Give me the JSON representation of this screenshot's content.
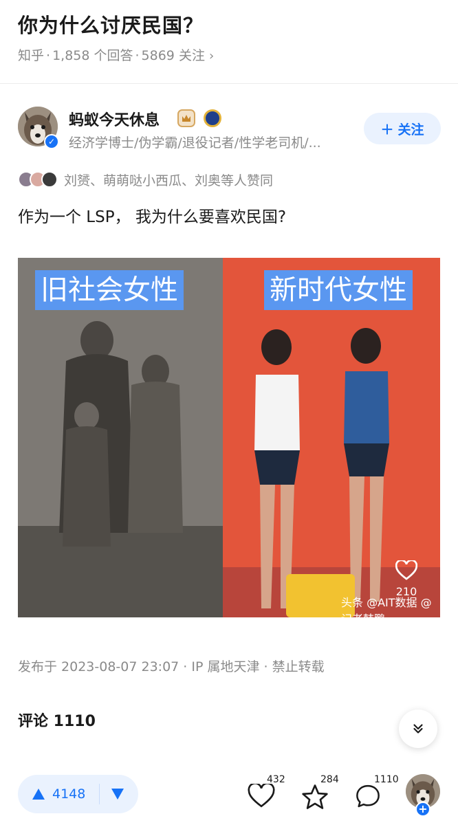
{
  "question": {
    "title": "你为什么讨厌民国？",
    "source": "知乎",
    "answers_count": "1,858 个回答",
    "followers": "5869 关注",
    "meta_chevron": "›"
  },
  "author": {
    "name": "蚂蚁今天休息",
    "bio": "经济学博士/伪学霸/退役记者/性学老司机/...",
    "follow_label": "关注",
    "follow_plus": "＋",
    "verify_mark": "✓"
  },
  "voters": {
    "text": "刘赟、萌萌哒小西瓜、刘奥等人赞同"
  },
  "answer": {
    "text": "作为一个 LSP， 我为什么要喜欢民国?"
  },
  "image": {
    "left_caption": "旧社会女性",
    "right_caption": "新时代女性",
    "like_count": "210",
    "watermark": "头条 @AIT数据 @记者韩鹏"
  },
  "meta": {
    "published": "发布于 2023-08-07 23:07 · IP 属地天津 · 禁止转载"
  },
  "comments": {
    "title": "评论 1110"
  },
  "bottom_bar": {
    "upvotes": "4148",
    "likes": "432",
    "favorites": "284",
    "comments": "1110",
    "add_plus": "+"
  },
  "colors": {
    "accent": "#1772f6",
    "accent_bg": "#eaf2fe",
    "muted_text": "#8a8a8a",
    "photo_right_bg": "#e5553a",
    "caption_bg": "#5a97f0"
  },
  "icons": [
    "chevron-right-icon",
    "verified-check-icon",
    "crown-badge-icon",
    "medal-badge-icon",
    "plus-icon",
    "heart-icon",
    "chevrons-down-icon",
    "upvote-triangle-icon",
    "downvote-triangle-icon",
    "star-icon",
    "comment-bubble-icon"
  ]
}
